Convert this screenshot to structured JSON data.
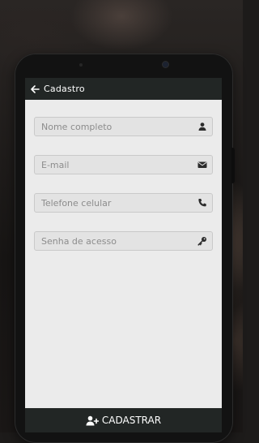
{
  "header": {
    "title": "Cadastro"
  },
  "form": {
    "fields": [
      {
        "placeholder": "Nome completo",
        "icon": "user-icon"
      },
      {
        "placeholder": "E-mail",
        "icon": "envelope-icon"
      },
      {
        "placeholder": "Telefone celular",
        "icon": "phone-icon"
      },
      {
        "placeholder": "Senha de acesso",
        "icon": "key-icon"
      }
    ]
  },
  "footer": {
    "submit_label": "CADASTRAR",
    "icon": "user-plus-icon"
  },
  "colors": {
    "appbar": "#222625",
    "screen": "#ebebeb",
    "field_bg": "#e3e3e3"
  }
}
